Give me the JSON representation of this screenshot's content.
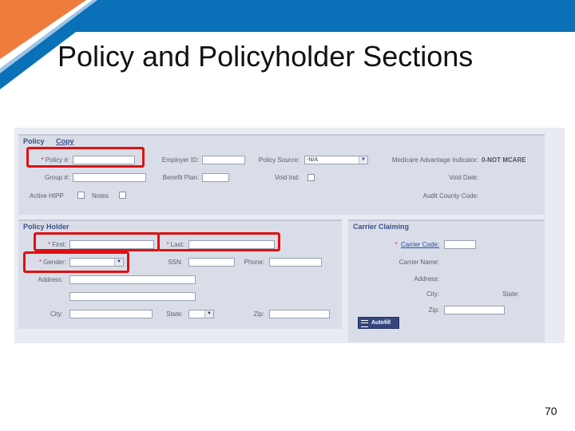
{
  "slide": {
    "title": "Policy and Policyholder Sections",
    "page_number": "70"
  },
  "colors": {
    "banner_blue": "#0a70b8",
    "banner_orange": "#f07c3c",
    "banner_light_blue": "#9ec4e4",
    "highlight_red": "#e01010",
    "label_blue": "#3a4f86"
  },
  "policy": {
    "header": "Policy",
    "copy_link": "Copy",
    "policy_num_label": "Policy #:",
    "employer_id_label": "Employer ID:",
    "policy_source_label": "Policy Source:",
    "policy_source_value": "-N/A",
    "medicare_label": "Medicare Advantage Indicator:",
    "medicare_value": "0-NOT MCARE",
    "group_num_label": "Group #:",
    "benefit_plan_label": "Benefit Plan:",
    "void_ind_label": "Void Ind:",
    "void_date_label": "Void Date:",
    "active_hipp_label": "Active HIPP",
    "notes_label": "Notes",
    "audit_county_label": "Audit County Code:"
  },
  "policy_holder": {
    "header": "Policy Holder",
    "first_label": "First:",
    "last_label": "Last:",
    "gender_label": "Gender:",
    "ssn_label": "SSN:",
    "phone_label": "Phone:",
    "address_label": "Address:",
    "city_label": "City:",
    "state_label": "State:",
    "zip_label": "Zip:"
  },
  "carrier_claiming": {
    "header": "Carrier Claiming",
    "carrier_code_link": "Carrier Code:",
    "carrier_name_label": "Carrier Name:",
    "address_label": "Address:",
    "city_label": "City:",
    "state_label": "State:",
    "zip_label": "Zip:",
    "autofill_label": "Autofill"
  },
  "required_marker": "*"
}
